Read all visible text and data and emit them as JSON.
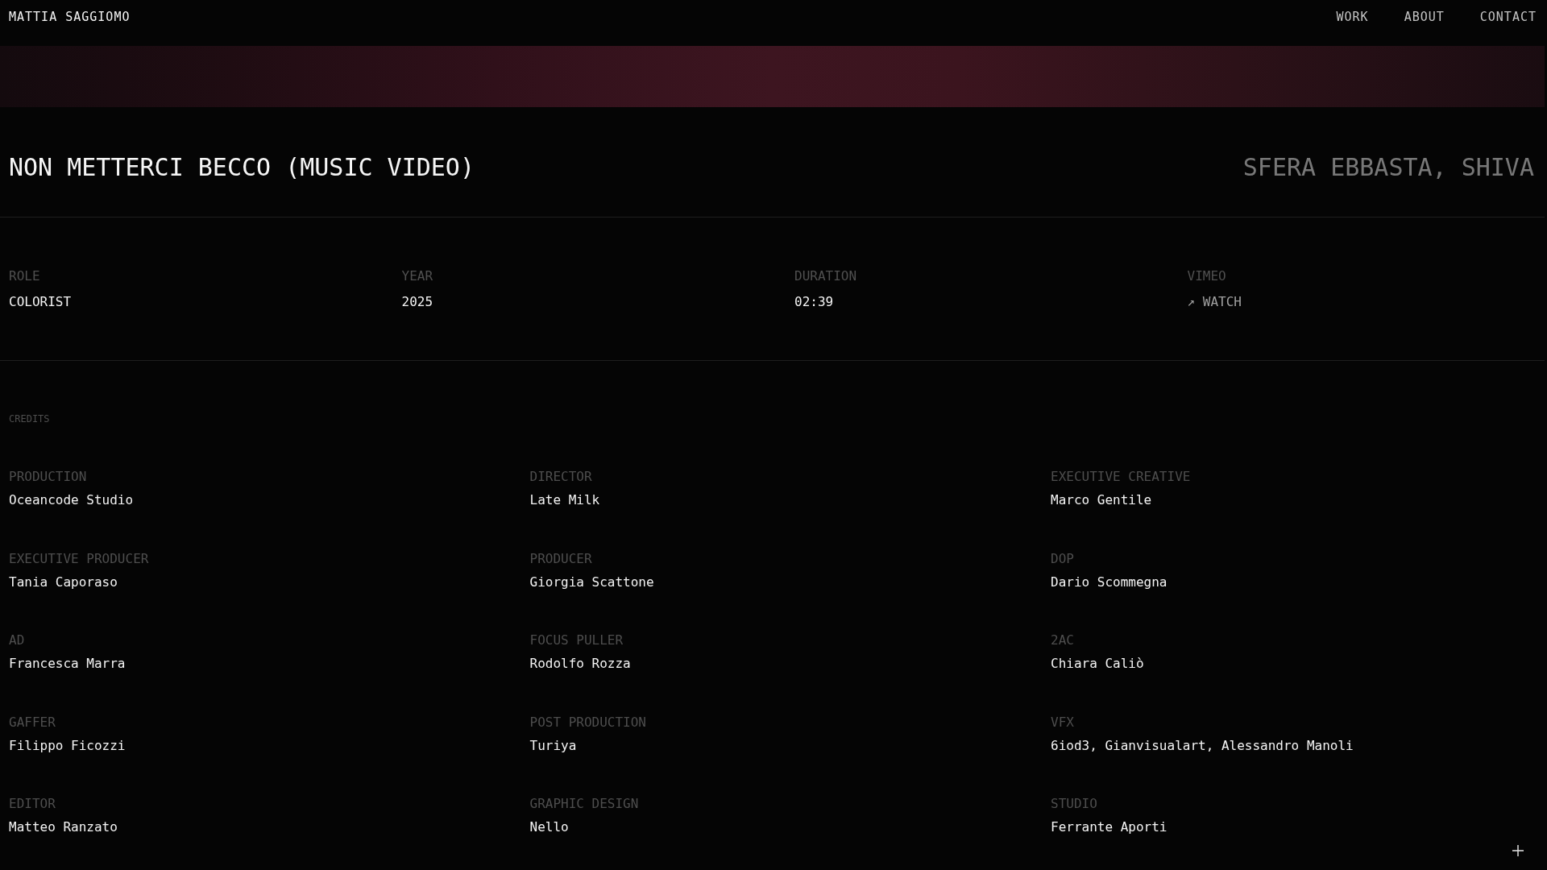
{
  "header": {
    "logo": "MATTIA SAGGIOMO",
    "nav": [
      "WORK",
      "ABOUT",
      "CONTACT"
    ]
  },
  "project": {
    "title": "NON METTERCI BECCO (MUSIC VIDEO)",
    "artist": "SFERA EBBASTA, SHIVA"
  },
  "details": [
    {
      "label": "ROLE",
      "value": "COLORIST",
      "kind": "text"
    },
    {
      "label": "YEAR",
      "value": "2025",
      "kind": "text"
    },
    {
      "label": "DURATION",
      "value": "02:39",
      "kind": "text"
    },
    {
      "label": "VIMEO",
      "value": "↗ WATCH",
      "kind": "link"
    }
  ],
  "credits": {
    "heading": "CREDITS",
    "items": [
      {
        "role": "PRODUCTION",
        "name": "Oceancode Studio"
      },
      {
        "role": "DIRECTOR",
        "name": "Late Milk"
      },
      {
        "role": "EXECUTIVE CREATIVE",
        "name": "Marco Gentile"
      },
      {
        "role": "EXECUTIVE PRODUCER",
        "name": "Tania Caporaso"
      },
      {
        "role": "PRODUCER",
        "name": "Giorgia Scattone"
      },
      {
        "role": "DOP",
        "name": "Dario Scommegna"
      },
      {
        "role": "AD",
        "name": "Francesca Marra"
      },
      {
        "role": "FOCUS PULLER",
        "name": "Rodolfo Rozza"
      },
      {
        "role": "2AC",
        "name": "Chiara Caliò"
      },
      {
        "role": "GAFFER",
        "name": "Filippo Ficozzi"
      },
      {
        "role": "POST PRODUCTION",
        "name": "Turiya"
      },
      {
        "role": "VFX",
        "name": "6iod3, Gianvisualart, Alessandro Manoli"
      },
      {
        "role": "EDITOR",
        "name": "Matteo Ranzato"
      },
      {
        "role": "GRAPHIC DESIGN",
        "name": "Nello"
      },
      {
        "role": "STUDIO",
        "name": "Ferrante Aporti"
      }
    ]
  }
}
